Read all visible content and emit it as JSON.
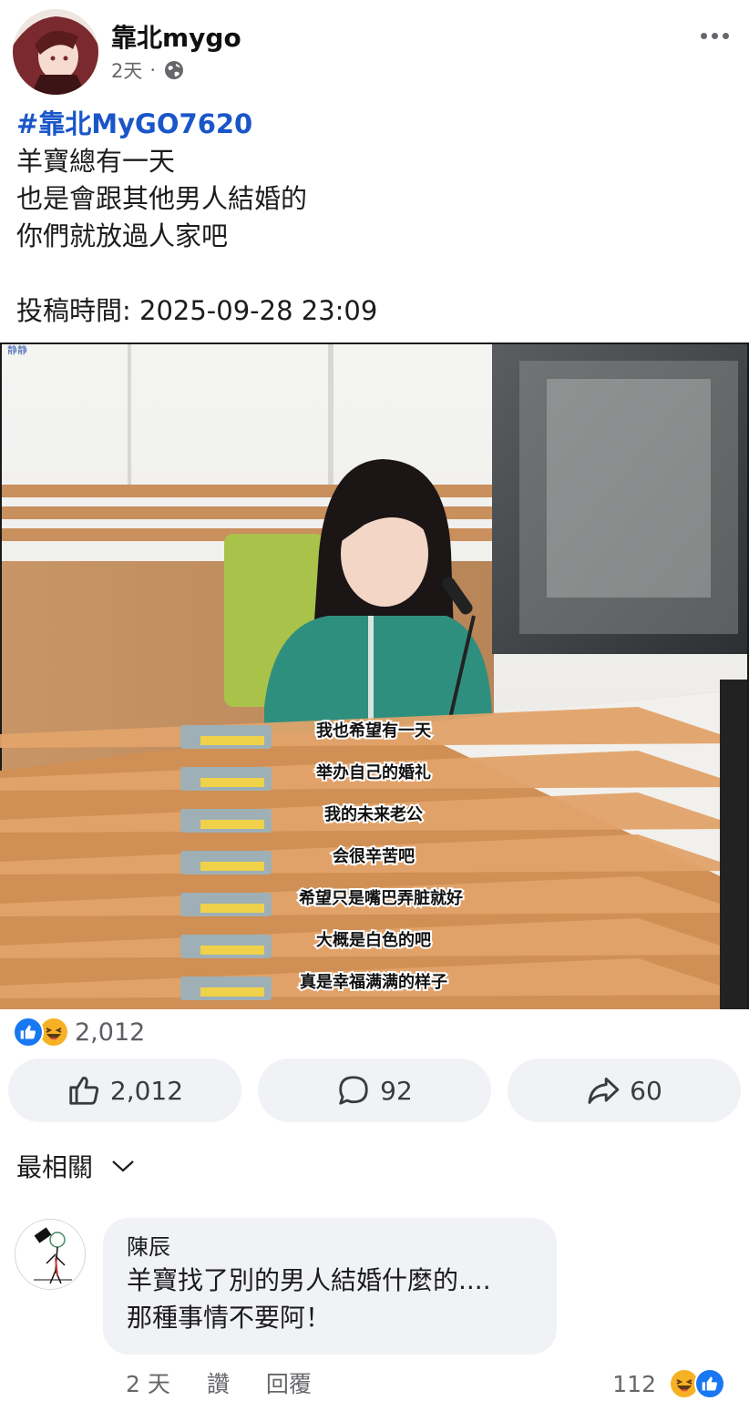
{
  "post": {
    "author": "靠北mygo",
    "time": "2天",
    "separator": "·",
    "privacy_icon": "globe-icon",
    "hashtag": "#靠北MyGO7620",
    "lines": [
      "羊寶總有一天",
      "也是會跟其他男人結婚的",
      "你們就放過人家吧"
    ],
    "submitted": "投稿時間: 2025-09-28 23:09"
  },
  "image": {
    "corner_tag": "静静",
    "subtitles": [
      "我也希望有一天",
      "举办自己的婚礼",
      "我的未来老公",
      "会很辛苦吧",
      "希望只是嘴巴弄脏就好",
      "大概是白色的吧",
      "真是幸福满满的样子"
    ]
  },
  "reactions": {
    "summary_count": "2,012",
    "icons": [
      "like-icon",
      "haha-icon"
    ],
    "like_label": "2,012",
    "comment_label": "92",
    "share_label": "60"
  },
  "sort": {
    "label": "最相關"
  },
  "comment": {
    "name": "陳辰",
    "lines": [
      "羊寶找了別的男人結婚什麼的....",
      "那種事情不要阿！"
    ],
    "time": "2 天",
    "like": "讚",
    "reply": "回覆",
    "react_count": "112"
  },
  "colors": {
    "hashtag": "#1a56c9",
    "like": "#1877f2",
    "haha": "#f7b125",
    "button_bg": "#f0f2f5"
  }
}
